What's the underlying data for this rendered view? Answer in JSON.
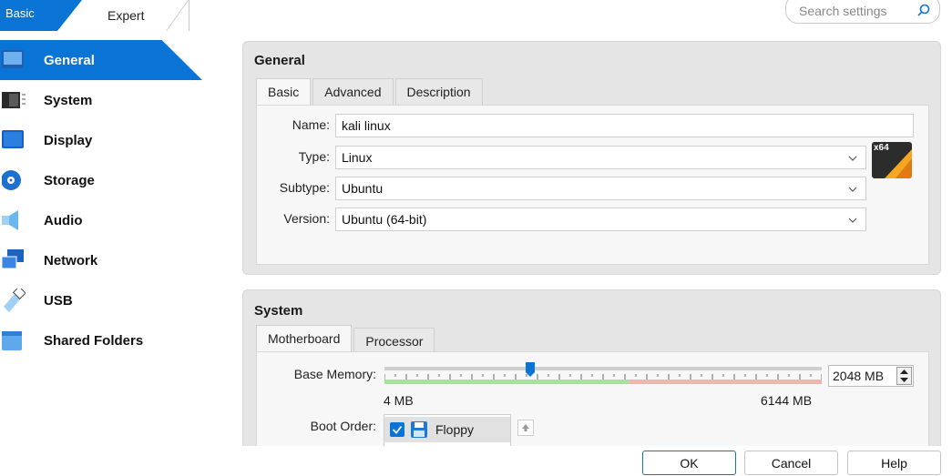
{
  "modes": {
    "basic": "Basic",
    "expert": "Expert"
  },
  "search": {
    "placeholder": "Search settings"
  },
  "sidebar": {
    "items": [
      {
        "label": "General",
        "icon": "general-icon",
        "active": true
      },
      {
        "label": "System",
        "icon": "system-chip-icon"
      },
      {
        "label": "Display",
        "icon": "display-monitor-icon"
      },
      {
        "label": "Storage",
        "icon": "storage-disk-icon"
      },
      {
        "label": "Audio",
        "icon": "audio-speaker-icon"
      },
      {
        "label": "Network",
        "icon": "network-icon"
      },
      {
        "label": "USB",
        "icon": "usb-icon"
      },
      {
        "label": "Shared Folders",
        "icon": "shared-folder-icon"
      }
    ]
  },
  "general": {
    "title": "General",
    "tabs": [
      "Basic",
      "Advanced",
      "Description"
    ],
    "name_label": "Name:",
    "name_value": "kali linux",
    "type_label": "Type:",
    "type_value": "Linux",
    "subtype_label": "Subtype:",
    "subtype_value": "Ubuntu",
    "version_label": "Version:",
    "version_value": "Ubuntu (64-bit)",
    "os_badge": "x64"
  },
  "system": {
    "title": "System",
    "tabs": [
      "Motherboard",
      "Processor"
    ],
    "base_memory_label": "Base Memory:",
    "memory_min": "4 MB",
    "memory_max": "6144 MB",
    "memory_value": "2048 MB",
    "memory_fraction": 0.333,
    "boot_order_label": "Boot Order:",
    "boot_items": [
      {
        "label": "Floppy",
        "checked": true
      }
    ]
  },
  "buttons": {
    "ok": "OK",
    "cancel": "Cancel",
    "help": "Help"
  },
  "colors": {
    "accent": "#0a74d6",
    "slider_ok": "#a8e0a0",
    "slider_warn": "#f2b4ae"
  }
}
